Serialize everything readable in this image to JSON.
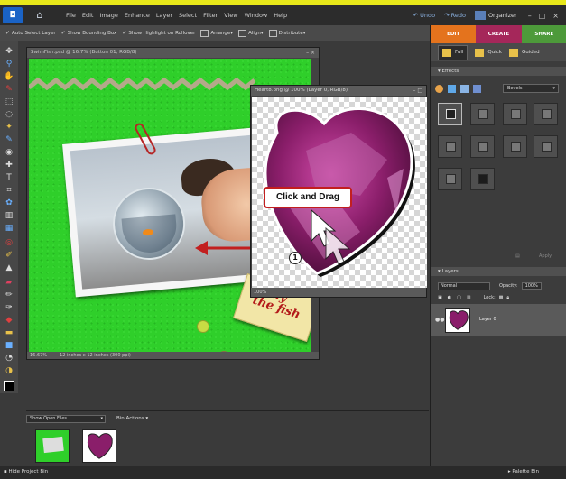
{
  "app": {
    "menu": [
      "File",
      "Edit",
      "Image",
      "Enhance",
      "Layer",
      "Select",
      "Filter",
      "View",
      "Window",
      "Help"
    ],
    "undo": "Undo",
    "redo": "Redo",
    "organizer": "Organizer"
  },
  "options_bar": {
    "auto_select": "Auto Select Layer",
    "bounding_box": "Show Bounding Box",
    "highlight": "Show Highlight on Rollover",
    "arrange": "Arrange",
    "align": "Align",
    "distribute": "Distribute"
  },
  "doc_window": {
    "title": "SwimFish.psd @ 16.7% (Button 01, RGB/8)",
    "zoom": "16.67%",
    "size_info": "12 inches x 12 inches (300 ppi)",
    "tag_text": "mmy\nthe fish"
  },
  "heart_window": {
    "title": "Heart8.png @ 100% (Layer 0, RGB/8)",
    "zoom": "100%",
    "callout": "Click and Drag",
    "step": "1"
  },
  "right_panel": {
    "tabs": [
      "EDIT",
      "CREATE",
      "SHARE"
    ],
    "modes": [
      "Full",
      "Quick",
      "Guided"
    ],
    "effects_header": "Effects",
    "effects_select": "Bevels",
    "apply": "Apply",
    "layers_header": "Layers",
    "blend_mode": "Normal",
    "opacity_label": "Opacity:",
    "opacity_value": "100%",
    "lock_label": "Lock:",
    "layer_name": "Layer 0"
  },
  "bin": {
    "select": "Show Open Files",
    "actions": "Bin Actions"
  },
  "bottom_bar": {
    "hide_bin": "Hide Project Bin",
    "palette_bin": "Palette Bin"
  },
  "colors": {
    "edit_tab": "#e4731d",
    "create_tab": "#a5275a",
    "share_tab": "#4d9a3a",
    "canvas_green": "#2fcf2a",
    "arrow_red": "#c21f1f"
  }
}
